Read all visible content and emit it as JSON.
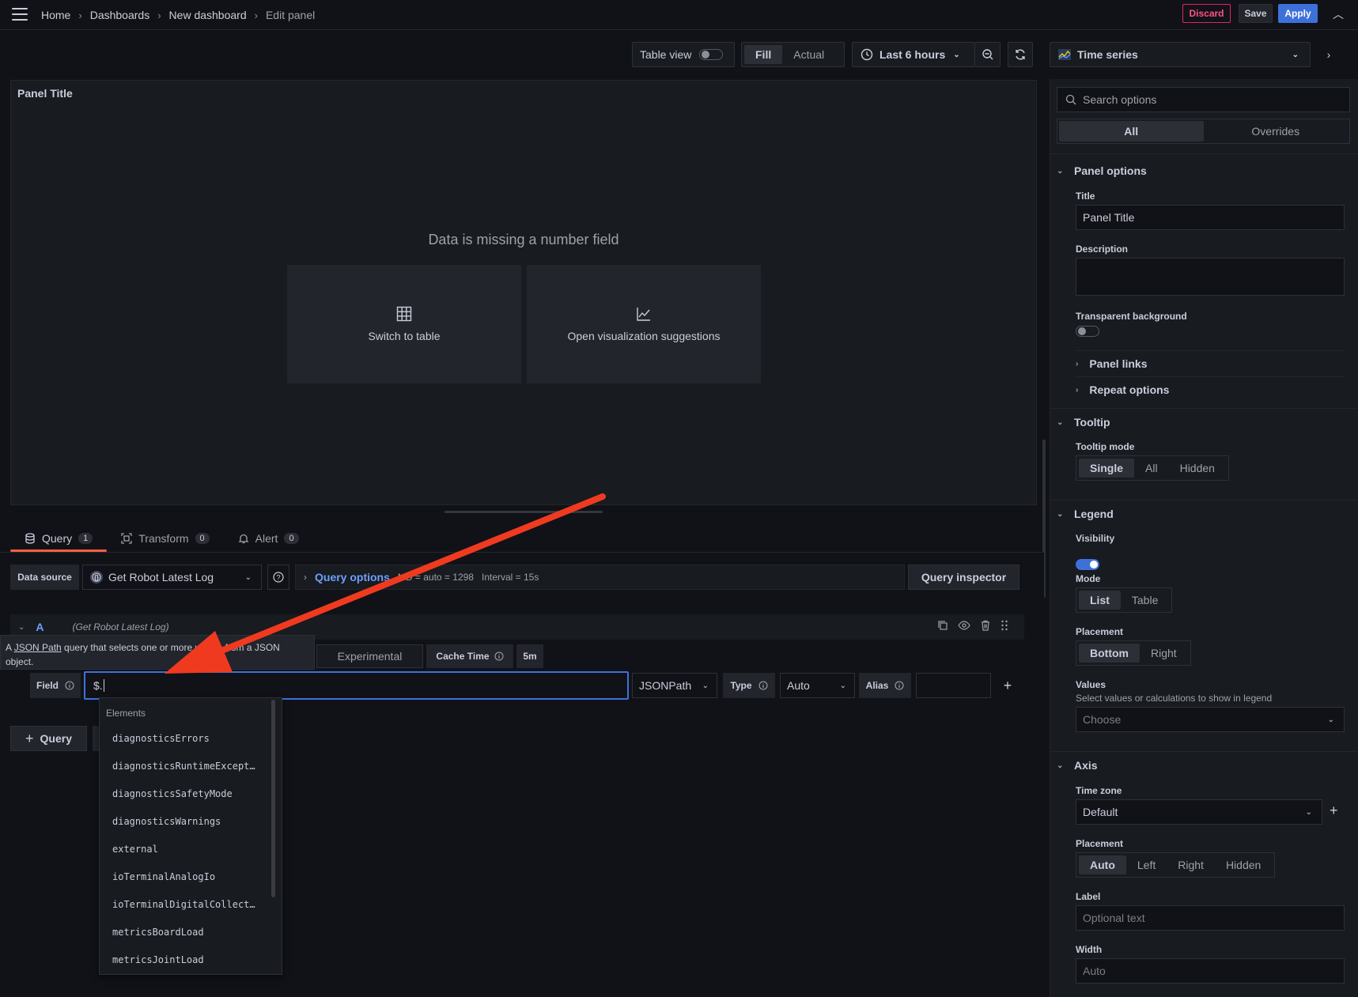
{
  "breadcrumb": [
    "Home",
    "Dashboards",
    "New dashboard",
    "Edit panel"
  ],
  "topbar": {
    "discard": "Discard",
    "save": "Save",
    "apply": "Apply"
  },
  "toolbar": {
    "table_view": "Table view",
    "fill": "Fill",
    "actual": "Actual",
    "time_range": "Last 6 hours",
    "visualization": "Time series"
  },
  "panel": {
    "title": "Panel Title",
    "message": "Data is missing a number field",
    "switch_table": "Switch to table",
    "open_suggestions": "Open visualization suggestions"
  },
  "tabs": [
    {
      "label": "Query",
      "count": "1"
    },
    {
      "label": "Transform",
      "count": "0"
    },
    {
      "label": "Alert",
      "count": "0"
    }
  ],
  "query": {
    "datasource_label": "Data source",
    "datasource": "Get Robot Latest Log",
    "query_options": "Query options",
    "md": "MD = auto = 1298",
    "interval": "Interval = 15s",
    "inspector": "Query inspector",
    "row_letter": "A",
    "row_datasource": "(Get Robot Latest Log)",
    "tooltip_pre": "A ",
    "tooltip_link": "JSON Path",
    "tooltip_post": " query that selects one or more values from a JSON object.",
    "experimental": "Experimental",
    "cache_time_label": "Cache Time",
    "cache_time": "5m",
    "field_label": "Field",
    "field_value": "$.",
    "jsonpath": "JSONPath",
    "type_label": "Type",
    "type_value": "Auto",
    "alias_label": "Alias",
    "add_query": "Query"
  },
  "autocomplete": {
    "group": "Elements",
    "items": [
      "diagnosticsErrors",
      "diagnosticsRuntimeExcept…",
      "diagnosticsSafetyMode",
      "diagnosticsWarnings",
      "external",
      "ioTerminalAnalogIo",
      "ioTerminalDigitalCollect…",
      "metricsBoardLoad",
      "metricsJointLoad"
    ]
  },
  "sidebar": {
    "search_placeholder": "Search options",
    "all": "All",
    "overrides": "Overrides",
    "panel_options": "Panel options",
    "title_label": "Title",
    "title_value": "Panel Title",
    "description_label": "Description",
    "transparent_label": "Transparent background",
    "panel_links": "Panel links",
    "repeat_options": "Repeat options",
    "tooltip": "Tooltip",
    "tooltip_mode_label": "Tooltip mode",
    "tooltip_modes": [
      "Single",
      "All",
      "Hidden"
    ],
    "legend": "Legend",
    "visibility_label": "Visibility",
    "mode_label": "Mode",
    "legend_modes": [
      "List",
      "Table"
    ],
    "placement_label": "Placement",
    "legend_placements": [
      "Bottom",
      "Right"
    ],
    "values_label": "Values",
    "values_desc": "Select values or calculations to show in legend",
    "values_placeholder": "Choose",
    "axis": "Axis",
    "timezone_label": "Time zone",
    "timezone_value": "Default",
    "axis_placement_label": "Placement",
    "axis_placements": [
      "Auto",
      "Left",
      "Right",
      "Hidden"
    ],
    "label_label": "Label",
    "label_placeholder": "Optional text",
    "width_label": "Width",
    "width_placeholder": "Auto"
  },
  "colors": {
    "accent": "#3d71d9",
    "arrow": "#f03a20",
    "tab_active": "#f55f3e"
  }
}
